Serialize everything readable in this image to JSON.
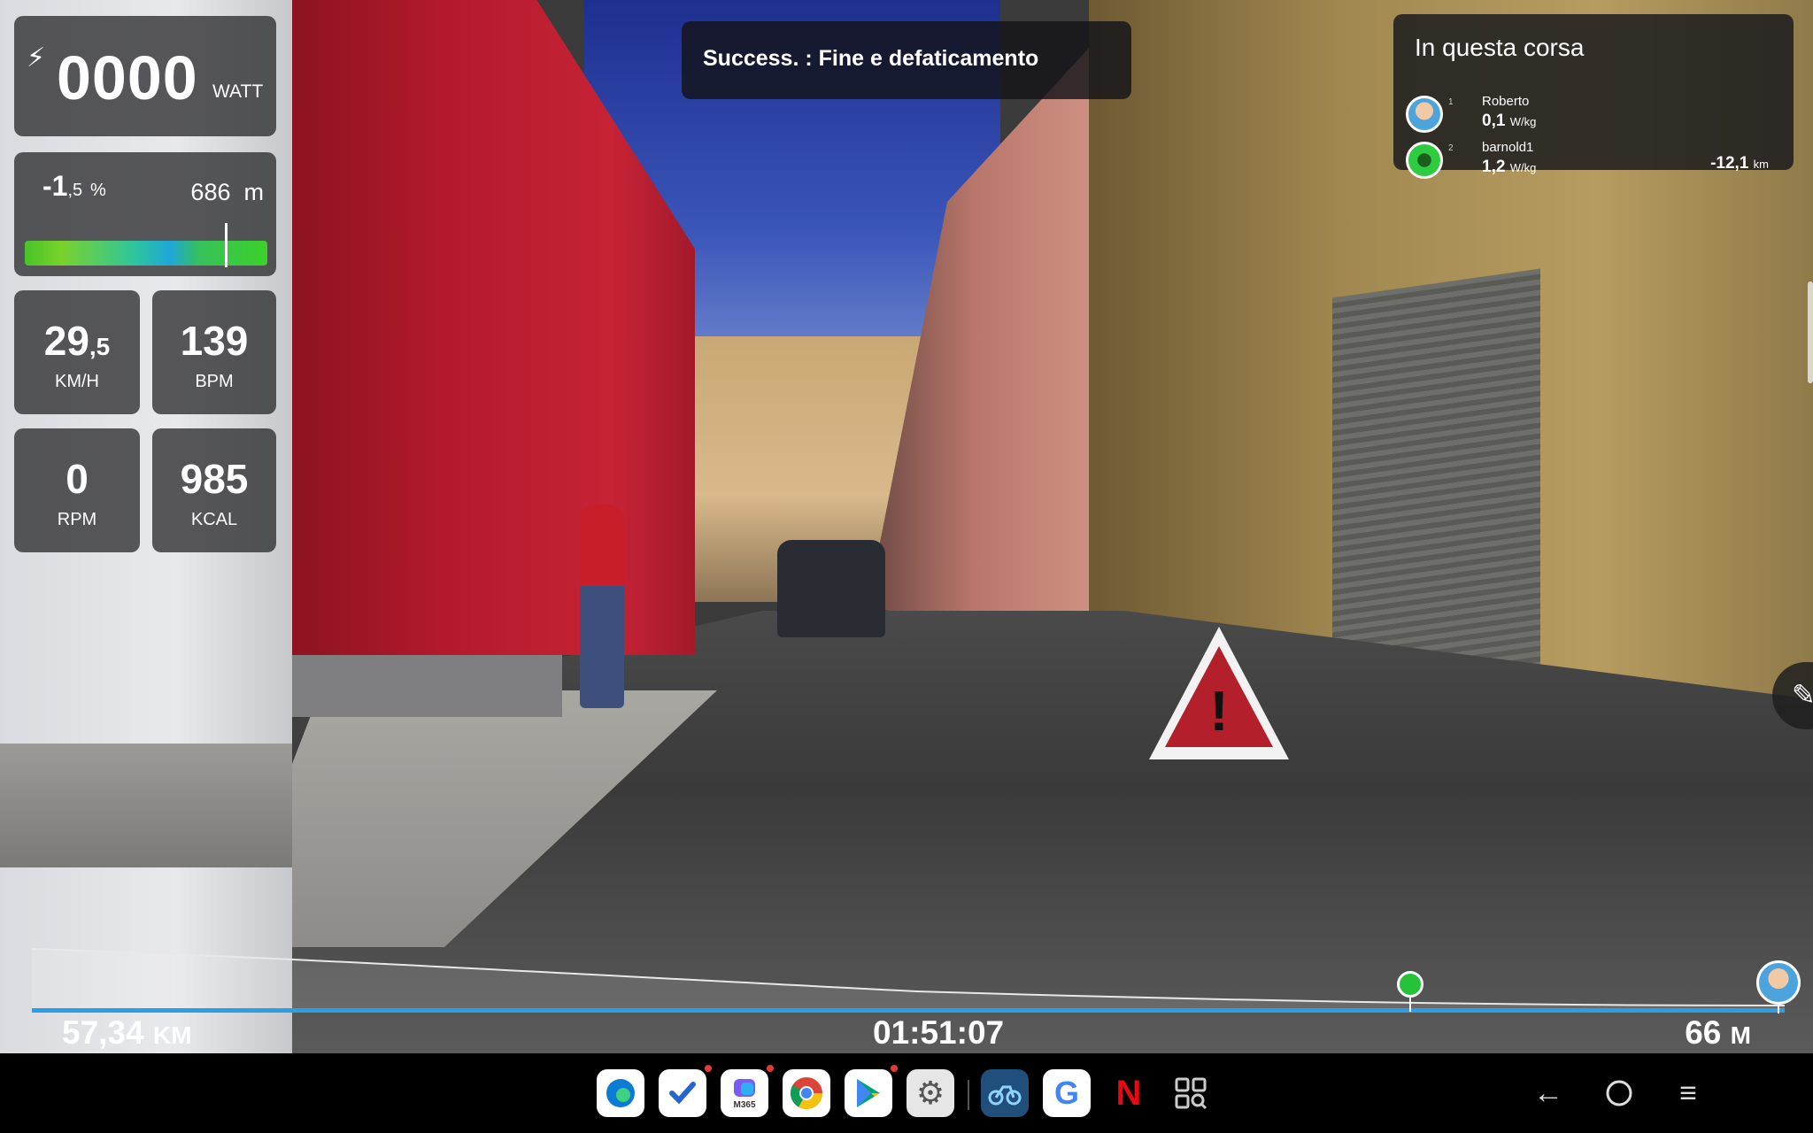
{
  "hud": {
    "power": {
      "value": "0000",
      "unit": "WATT",
      "icon": "lightning-icon"
    },
    "grade": {
      "value_int": "-1",
      "value_dec": ",5",
      "unit": "%",
      "altitude": "686",
      "altitude_unit": "m"
    },
    "speed": {
      "value_int": "29",
      "value_dec": ",5",
      "unit": "KM/H"
    },
    "heart_rate": {
      "value": "139",
      "unit": "BPM"
    },
    "cadence": {
      "value": "0",
      "unit": "RPM"
    },
    "calories": {
      "value": "985",
      "unit": "KCAL"
    }
  },
  "banner": {
    "text": "Success. : Fine e defaticamento"
  },
  "race_panel": {
    "title": "In questa corsa",
    "riders": [
      {
        "position": "1",
        "name": "Roberto",
        "wkg_value": "0,1",
        "wkg_unit": "W/kg",
        "distance_value": "",
        "distance_unit": ""
      },
      {
        "position": "2",
        "name": "barnold1",
        "wkg_value": "1,2",
        "wkg_unit": "W/kg",
        "distance_value": "-12,1",
        "distance_unit": "km"
      }
    ]
  },
  "bottom_bar": {
    "distance_value": "57,34",
    "distance_unit": "KM",
    "elapsed_time": "01:51:07",
    "remaining_value": "66",
    "remaining_unit": "M"
  },
  "taskbar": {
    "apps": [
      "edge-icon",
      "to-do-icon",
      "m365-icon",
      "chrome-icon",
      "play-store-icon",
      "settings-icon",
      "garmin-tacx-icon",
      "google-icon",
      "netflix-icon",
      "app-search-icon"
    ],
    "m365_label": "M365",
    "netflix_label": "N",
    "google_label": "G",
    "nav": [
      "back-icon",
      "home-icon",
      "recents-icon"
    ]
  },
  "colors": {
    "progress": "#2d9ee6",
    "accent_green": "#26c33a"
  }
}
